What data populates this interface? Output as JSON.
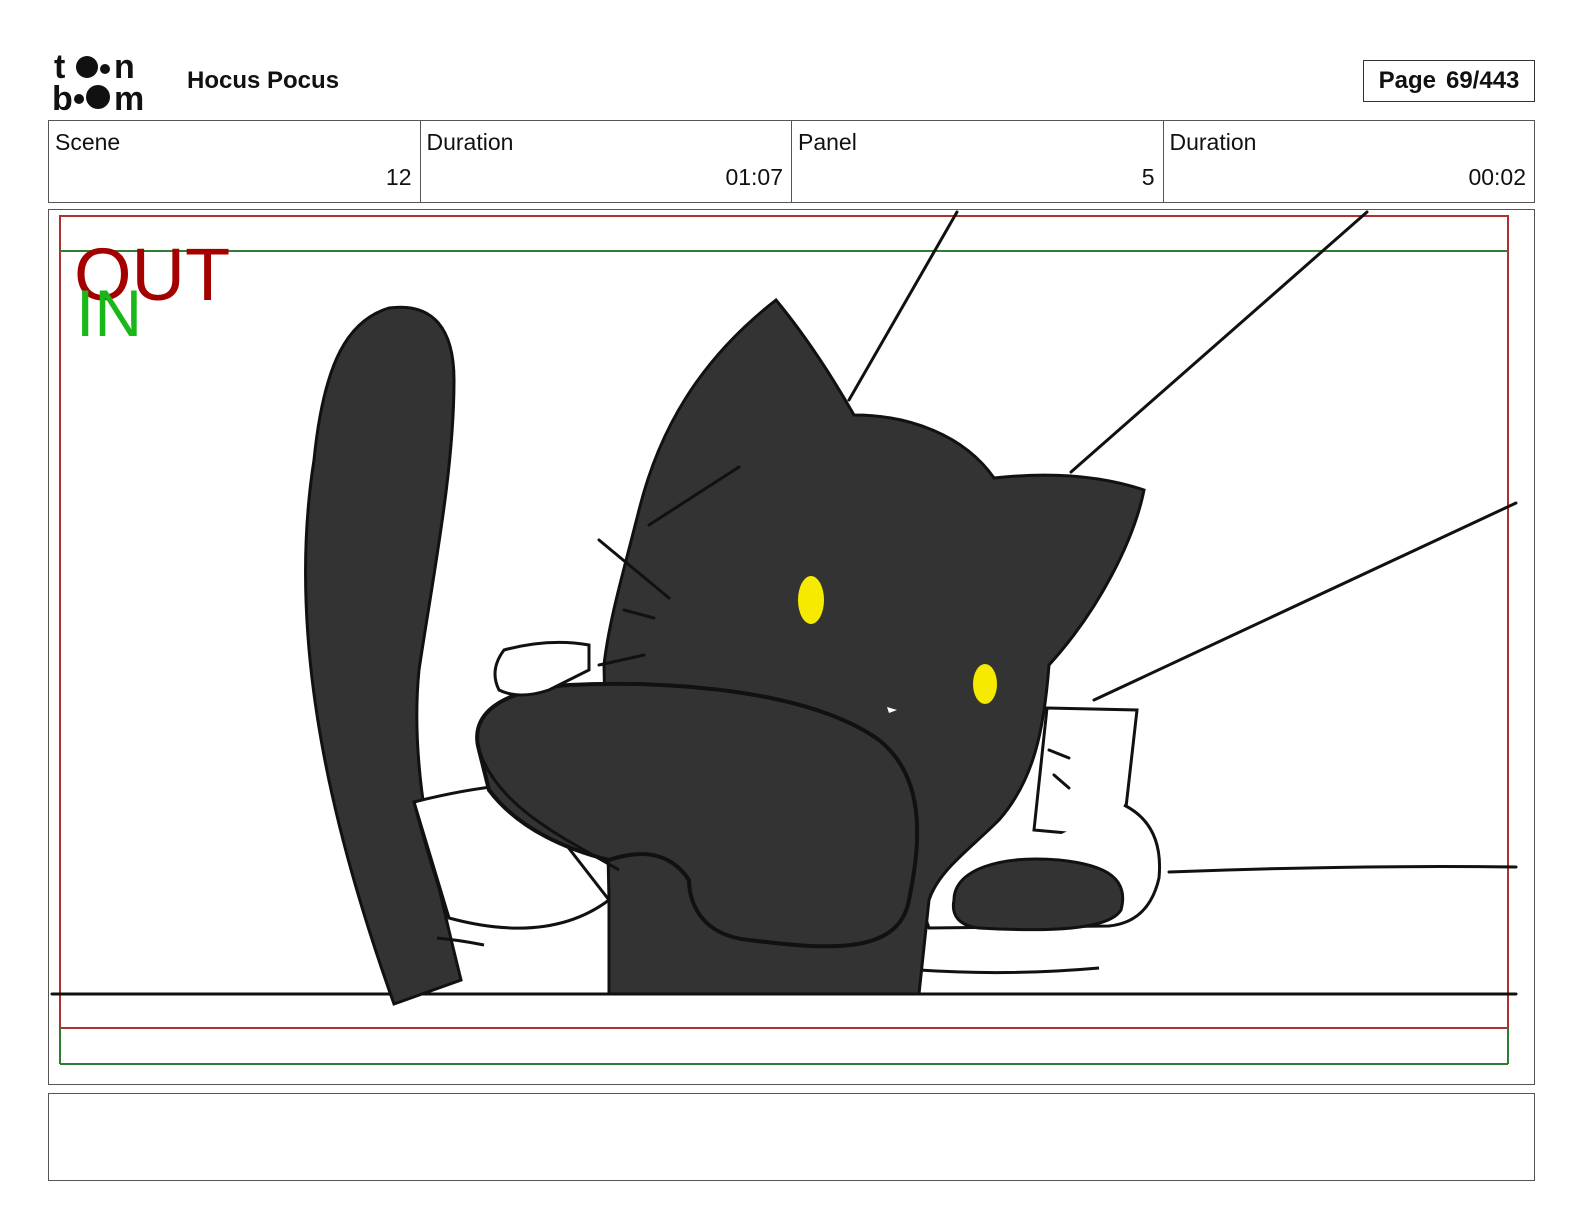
{
  "header": {
    "logo_icon": "toon-boom-logo",
    "project_title": "Hocus Pocus",
    "page_label": "Page",
    "page_number": "69/443"
  },
  "info": {
    "scene_label": "Scene",
    "scene_value": "12",
    "scene_duration_label": "Duration",
    "scene_duration_value": "01:07",
    "panel_label": "Panel",
    "panel_value": "5",
    "panel_duration_label": "Duration",
    "panel_duration_value": "00:02"
  },
  "panel": {
    "illustration_icon": "black-cat-sketch",
    "out_label": "OUT",
    "in_label": "IN",
    "colors": {
      "out_frame": "#b03030",
      "in_frame": "#2e7d32",
      "cat_fill": "#333333",
      "eye": "#f5ea00"
    }
  },
  "notes": {
    "text": ""
  }
}
